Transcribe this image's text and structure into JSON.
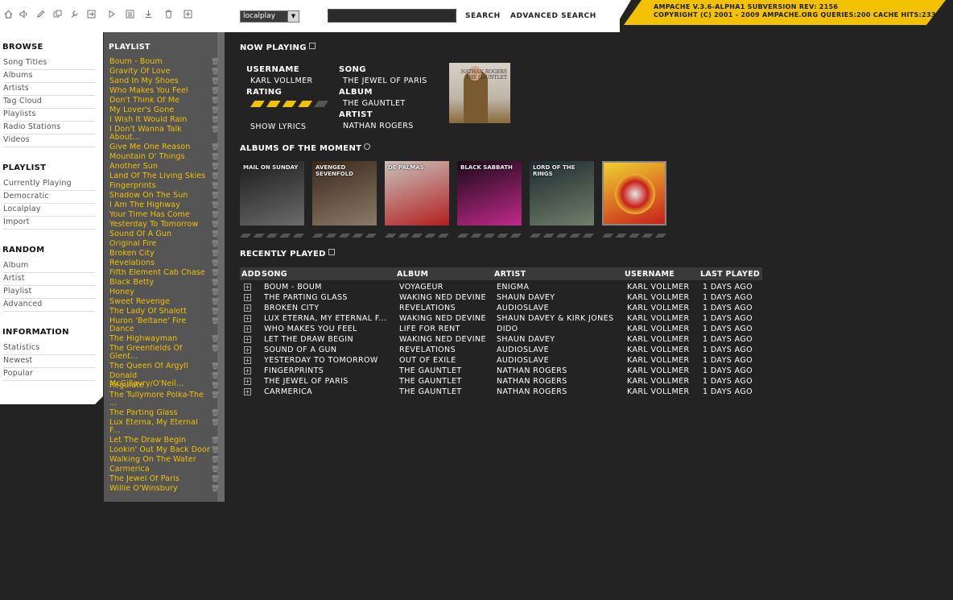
{
  "header": {
    "localplay_value": "localplay",
    "search_value": "",
    "search_label": "SEARCH",
    "advanced_search_label": "ADVANCED SEARCH",
    "version_line1": "AMPACHE V.3.6-ALPHA1 SUBVERSION REV: 2156",
    "version_line2": "COPYRIGHT (C) 2001 - 2009 AMPACHE.ORG QUERIES:200 CACHE HITS:233",
    "toolbar_icons": [
      "home-icon",
      "volume-icon",
      "edit-icon",
      "windows-icon",
      "tools-icon",
      "login-icon",
      "play-icon",
      "list-icon",
      "download-icon",
      "trash-icon",
      "add-icon"
    ]
  },
  "sidebar": {
    "browse_title": "BROWSE",
    "browse_items": [
      "Song Titles",
      "Albums",
      "Artists",
      "Tag Cloud",
      "Playlists",
      "Radio Stations",
      "Videos"
    ],
    "playlist_title": "PLAYLIST",
    "playlist_items": [
      "Currently Playing",
      "Democratic",
      "Localplay",
      "Import"
    ],
    "random_title": "RANDOM",
    "random_items": [
      "Album",
      "Artist",
      "Playlist",
      "Advanced"
    ],
    "information_title": "INFORMATION",
    "information_items": [
      "Statistics",
      "Newest",
      "Popular"
    ]
  },
  "playlist": {
    "title": "PLAYLIST",
    "items": [
      {
        "name": "Boum - Boum",
        "wrap": false
      },
      {
        "name": "Gravity Of Love",
        "wrap": false
      },
      {
        "name": "Sand In My Shoes",
        "wrap": false
      },
      {
        "name": "Who Makes You Feel",
        "wrap": false
      },
      {
        "name": "Don't Think Of Me",
        "wrap": false
      },
      {
        "name": "My Lover's Gone",
        "wrap": false
      },
      {
        "name": "I Wish It Would Rain",
        "wrap": false
      },
      {
        "name": "I Don't Wanna Talk About...",
        "wrap": true
      },
      {
        "name": "Give Me One Reason",
        "wrap": false
      },
      {
        "name": "Mountain O' Things",
        "wrap": false
      },
      {
        "name": "Another Sun",
        "wrap": false
      },
      {
        "name": "Land Of The Living Skies",
        "wrap": false
      },
      {
        "name": "Fingerprints",
        "wrap": false
      },
      {
        "name": "Shadow On The Sun",
        "wrap": false
      },
      {
        "name": "I Am The Highway",
        "wrap": false
      },
      {
        "name": "Your Time Has Come",
        "wrap": false
      },
      {
        "name": "Yesterday To Tomorrow",
        "wrap": false
      },
      {
        "name": "Sound Of A Gun",
        "wrap": false
      },
      {
        "name": "Original Fire",
        "wrap": false
      },
      {
        "name": "Broken City",
        "wrap": false
      },
      {
        "name": "Revelations",
        "wrap": false
      },
      {
        "name": "Fifth Element Cab Chase",
        "wrap": false
      },
      {
        "name": "Black Betty",
        "wrap": false
      },
      {
        "name": "Honey",
        "wrap": false
      },
      {
        "name": "Sweet Revenge",
        "wrap": false
      },
      {
        "name": "The Lady Of Shalott",
        "wrap": false
      },
      {
        "name": "Huron 'Beltane' Fire Dance",
        "wrap": true
      },
      {
        "name": "The Highwayman",
        "wrap": false
      },
      {
        "name": "The Greenfields Of Glent...",
        "wrap": true
      },
      {
        "name": "The Queen Of Argyll",
        "wrap": false
      },
      {
        "name": "Donald McGillavry/O'Neil...",
        "wrap": false
      },
      {
        "name": "Regulate",
        "wrap": false
      },
      {
        "name": "The Tullymore Polka-The ...",
        "wrap": true
      },
      {
        "name": "The Parting Glass",
        "wrap": false
      },
      {
        "name": "Lux Eterna, My Eternal F...",
        "wrap": true
      },
      {
        "name": "Let The Draw Begin",
        "wrap": false
      },
      {
        "name": "Lookin' Out My Back Door",
        "wrap": false
      },
      {
        "name": "Walking On The Water",
        "wrap": false
      },
      {
        "name": "Carmerica",
        "wrap": false
      },
      {
        "name": "The Jewel Of Paris",
        "wrap": false
      },
      {
        "name": "Willie O'Winsbury",
        "wrap": false
      }
    ]
  },
  "now_playing": {
    "title": "NOW PLAYING",
    "username_label": "USERNAME",
    "username": "KARL VOLLMER",
    "rating_label": "RATING",
    "rating_value": 4,
    "rating_max": 5,
    "show_lyrics": "SHOW LYRICS",
    "song_label": "SONG",
    "song": "THE JEWEL OF PARIS",
    "album_label": "ALBUM",
    "album": "THE GAUNTLET",
    "artist_label": "ARTIST",
    "artist": "NATHAN ROGERS",
    "art_text": "NATHAN ROGERS THE GAUNTLET"
  },
  "albums_of_moment": {
    "title": "ALBUMS OF THE MOMENT",
    "albums": [
      {
        "name": "florida-mail-on-sunday",
        "text": "MAIL ON SUNDAY",
        "colors": [
          "#1c1c1c",
          "#6b6b6b"
        ]
      },
      {
        "name": "avenged-sevenfold",
        "text": "AVENGED SEVENFOLD",
        "colors": [
          "#3b2a1c",
          "#8a7a68"
        ]
      },
      {
        "name": "de-palmas",
        "text": "DE PALMAS",
        "colors": [
          "#c8c3bd",
          "#b21e1e"
        ]
      },
      {
        "name": "black-sabbath",
        "text": "BLACK SABBATH",
        "colors": [
          "#1a0a18",
          "#c02a8a"
        ]
      },
      {
        "name": "lord-of-the-rings",
        "text": "LORD OF THE RINGS",
        "colors": [
          "#1e2a30",
          "#6f7f6a"
        ]
      },
      {
        "name": "screaming-for-vengeance",
        "text": "",
        "colors": [
          "#f0d030",
          "#c8201a"
        ]
      }
    ]
  },
  "recently_played": {
    "title": "RECENTLY PLAYED",
    "columns": [
      "ADD",
      "SONG",
      "ALBUM",
      "ARTIST",
      "USERNAME",
      "LAST PLAYED"
    ],
    "rows": [
      [
        "BOUM - BOUM",
        "VOYAGEUR",
        "ENIGMA",
        "KARL VOLLMER",
        "1 DAYS AGO"
      ],
      [
        "THE PARTING GLASS",
        "WAKING NED DEVINE",
        "SHAUN DAVEY",
        "KARL VOLLMER",
        "1 DAYS AGO"
      ],
      [
        "BROKEN CITY",
        "REVELATIONS",
        "AUDIOSLAVE",
        "KARL VOLLMER",
        "1 DAYS AGO"
      ],
      [
        "LUX ETERNA, MY ETERNAL F...",
        "WAKING NED DEVINE",
        "SHAUN DAVEY & KIRK JONES",
        "KARL VOLLMER",
        "1 DAYS AGO"
      ],
      [
        "WHO MAKES YOU FEEL",
        "LIFE FOR RENT",
        "DIDO",
        "KARL VOLLMER",
        "1 DAYS AGO"
      ],
      [
        "LET THE DRAW BEGIN",
        "WAKING NED DEVINE",
        "SHAUN DAVEY",
        "KARL VOLLMER",
        "1 DAYS AGO"
      ],
      [
        "SOUND OF A GUN",
        "REVELATIONS",
        "AUDIOSLAVE",
        "KARL VOLLMER",
        "1 DAYS AGO"
      ],
      [
        "YESTERDAY TO TOMORROW",
        "OUT OF EXILE",
        "AUDIOSLAVE",
        "KARL VOLLMER",
        "1 DAYS AGO"
      ],
      [
        "FINGERPRINTS",
        "THE GAUNTLET",
        "NATHAN ROGERS",
        "KARL VOLLMER",
        "1 DAYS AGO"
      ],
      [
        "THE JEWEL OF PARIS",
        "THE GAUNTLET",
        "NATHAN ROGERS",
        "KARL VOLLMER",
        "1 DAYS AGO"
      ],
      [
        "CARMERICA",
        "THE GAUNTLET",
        "NATHAN ROGERS",
        "KARL VOLLMER",
        "1 DAYS AGO"
      ]
    ]
  },
  "colors": {
    "accent": "#f2c200",
    "background": "#232323",
    "panel": "#555555"
  }
}
